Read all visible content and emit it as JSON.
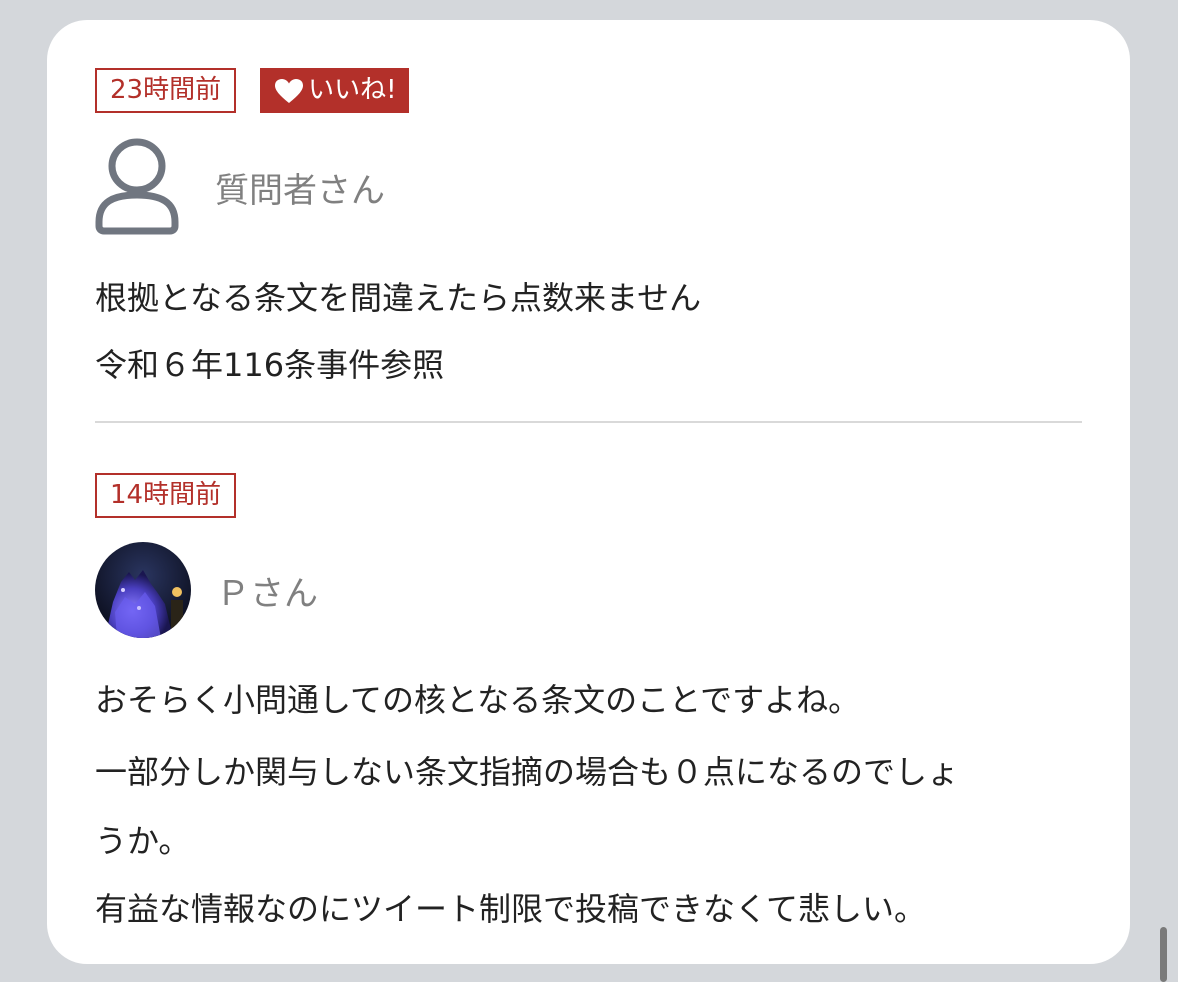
{
  "post1": {
    "time_label": "23時間前",
    "like_label": "いいね!",
    "user_name": "質問者さん",
    "lines": [
      "根拠となる条文を間違えたら点数来ません",
      "令和６年116条事件参照"
    ]
  },
  "post2": {
    "time_label": "14時間前",
    "user_name": "Ｐさん",
    "lines": [
      "おそらく小問通しての核となる条文のことですよね。",
      "一部分しか関与しない条文指摘の場合も０点になるのでしょ",
      "うか。",
      "有益な情報なのにツイート制限で投稿できなくて悲しい。"
    ]
  },
  "colors": {
    "accent": "#b3302a",
    "username": "#808080",
    "text": "#222222",
    "background": "#d4d7db",
    "card": "#ffffff"
  },
  "icons": {
    "like": "heart-icon",
    "default_avatar": "user-outline-icon"
  }
}
